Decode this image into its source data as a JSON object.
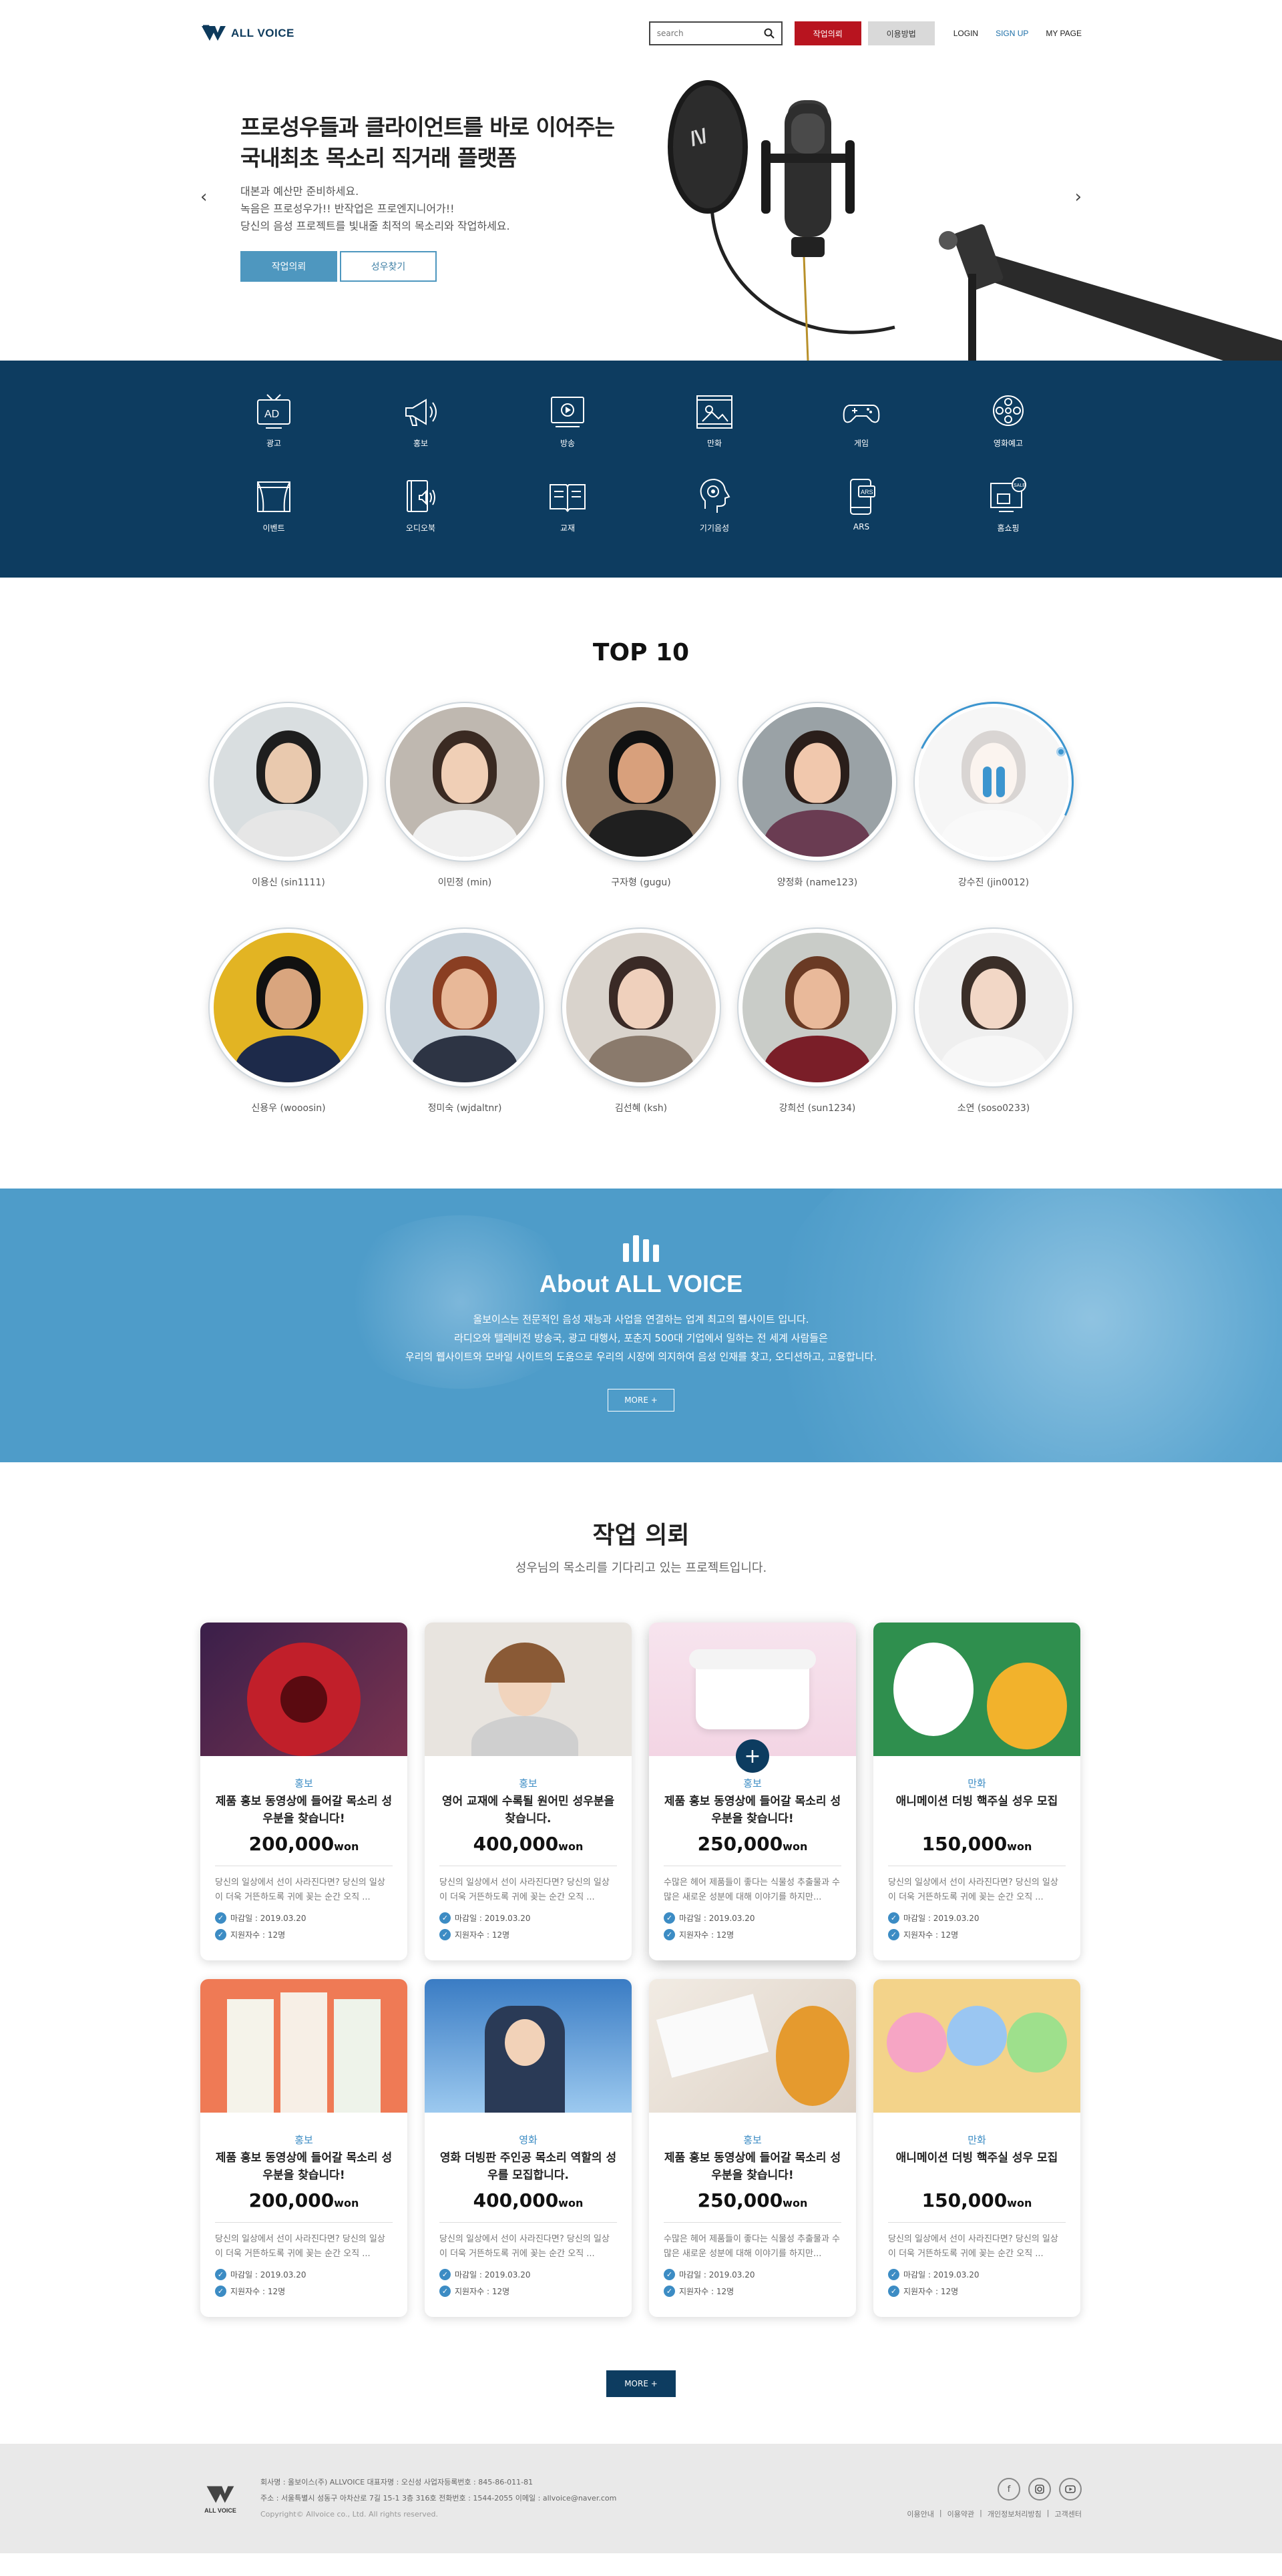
{
  "header": {
    "logo_text": "ALL VOICE",
    "search_placeholder": "search",
    "btn_request": "작업의뢰",
    "btn_guide": "이용방법",
    "login": "LOGIN",
    "signup": "SIGN UP",
    "mypage": "MY PAGE"
  },
  "hero": {
    "title_line1": "프로성우들과 클라이언트를 바로 이어주는",
    "title_line2": "국내최초 목소리 직거래 플랫폼",
    "desc_line1": "대본과 예산만 준비하세요.",
    "desc_line2": "녹음은 프로성우가!! 반작업은 프로엔지니어가!!",
    "desc_line3": "당신의 음성 프로젝트를 빛내줄 최적의 목소리와 작업하세요.",
    "btn_primary": "작업의뢰",
    "btn_secondary": "성우찾기"
  },
  "categories": [
    {
      "label": "광고",
      "icon": "ad-tv-icon"
    },
    {
      "label": "홍보",
      "icon": "megaphone-icon"
    },
    {
      "label": "방송",
      "icon": "broadcast-icon"
    },
    {
      "label": "만화",
      "icon": "cartoon-icon"
    },
    {
      "label": "게임",
      "icon": "gamepad-icon"
    },
    {
      "label": "영화예고",
      "icon": "film-reel-icon"
    },
    {
      "label": "이벤트",
      "icon": "stage-icon"
    },
    {
      "label": "오디오북",
      "icon": "audiobook-icon"
    },
    {
      "label": "교재",
      "icon": "book-icon"
    },
    {
      "label": "기기음성",
      "icon": "device-voice-icon"
    },
    {
      "label": "ARS",
      "icon": "ars-phone-icon"
    },
    {
      "label": "홈쇼핑",
      "icon": "home-shopping-icon"
    }
  ],
  "top10": {
    "title": "TOP 10",
    "people": [
      {
        "name": "이용신 (sin1111)"
      },
      {
        "name": "이민정 (min)"
      },
      {
        "name": "구자형 (gugu)"
      },
      {
        "name": "양정화 (name123)"
      },
      {
        "name": "강수진 (jin0012)"
      },
      {
        "name": "신용우 (wooosin)"
      },
      {
        "name": "정미숙 (wjdaltnr)"
      },
      {
        "name": "김선혜 (ksh)"
      },
      {
        "name": "강희선 (sun1234)"
      },
      {
        "name": "소연 (soso0233)"
      }
    ]
  },
  "about": {
    "title": "About ALL VOICE",
    "line1": "올보이스는 전문적인 음성 재능과 사업을 연결하는 업계 최고의 웹사이트 입니다.",
    "line2": "라디오와 텔레비전 방송국, 광고 대행사, 포춘지 500대 기업에서 일하는 전 세계 사람들은",
    "line3": "우리의 웹사이트와 모바일 사이트의 도움으로 우리의 시장에 의지하여 음성 인재를 찾고, 오디션하고, 고용합니다.",
    "more": "MORE +"
  },
  "requests": {
    "title": "작업 의뢰",
    "subtitle": "성우님의 목소리를 기다리고 있는 프로젝트입니다.",
    "more": "MORE +",
    "cards": [
      {
        "category": "홍보",
        "title": "제품 홍보 동영상에 들어갈 목소리 성우분을 찾습니다!",
        "price": "200,000",
        "unit": "won",
        "desc": "당신의 일상에서 선이 사라진다면? 당신의 일상이 더욱 거뜬하도록 귀에 꽂는 순간 오직 ...",
        "deadline": "마감일 : 2019.03.20",
        "applicants": "지원자수 : 12명"
      },
      {
        "category": "홍보",
        "title": "영어 교재에 수록될 원어민 성우분을 찾습니다.",
        "price": "400,000",
        "unit": "won",
        "desc": "당신의 일상에서 선이 사라진다면? 당신의 일상이 더욱 거뜬하도록 귀에 꽂는 순간 오직 ...",
        "deadline": "마감일 : 2019.03.20",
        "applicants": "지원자수 : 12명"
      },
      {
        "category": "홍보",
        "title": "제품 홍보 동영상에 들어갈 목소리 성우분을 찾습니다!",
        "price": "250,000",
        "unit": "won",
        "desc": "수많은 헤어 제품들이 좋다는 식물성 추출물과 수많은 새로운 성분에 대해 이야기를 하지만...",
        "deadline": "마감일 : 2019.03.20",
        "applicants": "지원자수 : 12명"
      },
      {
        "category": "만화",
        "title": "애니메이션 더빙 핵주실 성우 모집",
        "price": "150,000",
        "unit": "won",
        "desc": "당신의 일상에서 선이 사라진다면? 당신의 일상이 더욱 거뜬하도록 귀에 꽂는 순간 오직 ...",
        "deadline": "마감일 : 2019.03.20",
        "applicants": "지원자수 : 12명"
      },
      {
        "category": "홍보",
        "title": "제품 홍보 동영상에 들어갈 목소리 성우분을 찾습니다!",
        "price": "200,000",
        "unit": "won",
        "desc": "당신의 일상에서 선이 사라진다면? 당신의 일상이 더욱 거뜬하도록 귀에 꽂는 순간 오직 ...",
        "deadline": "마감일 : 2019.03.20",
        "applicants": "지원자수 : 12명"
      },
      {
        "category": "영화",
        "title": "영화 더빙판 주인공 목소리 역할의 성우를 모집합니다.",
        "price": "400,000",
        "unit": "won",
        "desc": "당신의 일상에서 선이 사라진다면? 당신의 일상이 더욱 거뜬하도록 귀에 꽂는 순간 오직 ...",
        "deadline": "마감일 : 2019.03.20",
        "applicants": "지원자수 : 12명"
      },
      {
        "category": "홍보",
        "title": "제품 홍보 동영상에 들어갈 목소리 성우분을 찾습니다!",
        "price": "250,000",
        "unit": "won",
        "desc": "수많은 헤어 제품들이 좋다는 식물성 추출물과 수많은 새로운 성분에 대해 이야기를 하지만...",
        "deadline": "마감일 : 2019.03.20",
        "applicants": "지원자수 : 12명"
      },
      {
        "category": "만화",
        "title": "애니메이션 더빙 핵주실 성우 모집",
        "price": "150,000",
        "unit": "won",
        "desc": "당신의 일상에서 선이 사라진다면? 당신의 일상이 더욱 거뜬하도록 귀에 꽂는 순간 오직 ...",
        "deadline": "마감일 : 2019.03.20",
        "applicants": "지원자수 : 12명"
      }
    ]
  },
  "footer": {
    "logo_text": "ALL VOICE",
    "line1": "회사명 : 올보이스(주) ALLVOICE  대표자명 : 오신성  사업자등록번호 : 845-86-011-81",
    "line2": "주소 : 서울특별시 성동구 아차산로 7길 15-1 3층 316호  전화번호 : 1544-2055  이메일 : allvoice@naver.com",
    "copyright": "Copyright© Allvoice co., Ltd. All rights reserved.",
    "links": [
      "이용안내",
      "이용약관",
      "개인정보처리방침",
      "고객센터"
    ]
  }
}
